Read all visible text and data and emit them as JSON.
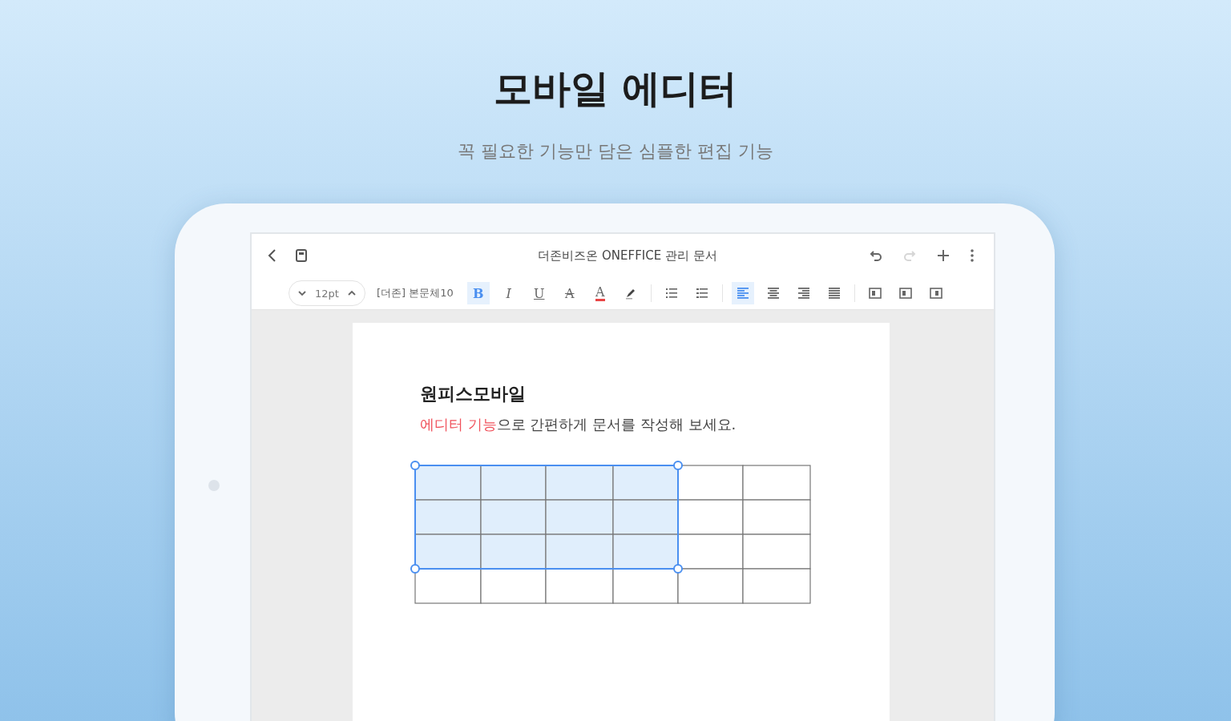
{
  "headline": "모바일 에디터",
  "subtitle": "꼭 필요한 기능만 담은 심플한 편집 기능",
  "editor": {
    "title": "더존비즈온 ONEFFICE 관리 문서",
    "actions": [
      {
        "kind": "undo",
        "disabled": false
      },
      {
        "kind": "redo",
        "disabled": true
      },
      {
        "kind": "add",
        "disabled": false
      },
      {
        "kind": "more",
        "disabled": false
      }
    ],
    "font_size": "12pt",
    "paragraph_style": "[더존] 본문체10",
    "tools": [
      {
        "kind": "bold",
        "label": "B",
        "selected": true
      },
      {
        "kind": "italic",
        "label": "I",
        "selected": false
      },
      {
        "kind": "underline",
        "label": "U",
        "selected": false
      },
      {
        "kind": "strike",
        "label": "A",
        "selected": false
      },
      {
        "kind": "font-color",
        "label": "A",
        "selected": false
      },
      {
        "kind": "highlight",
        "selected": false
      },
      {
        "kind": "separator"
      },
      {
        "kind": "bullets",
        "selected": false
      },
      {
        "kind": "numbering",
        "selected": false
      },
      {
        "kind": "separator"
      },
      {
        "kind": "align-left",
        "selected": true
      },
      {
        "kind": "align-center",
        "selected": false
      },
      {
        "kind": "align-right",
        "selected": false
      },
      {
        "kind": "justify",
        "selected": false
      },
      {
        "kind": "separator"
      },
      {
        "kind": "indent",
        "selected": false
      },
      {
        "kind": "outdent",
        "selected": false
      },
      {
        "kind": "table",
        "selected": false
      }
    ]
  },
  "document": {
    "heading": "원피스모바일",
    "sentence": "**에디터 기능**으로 간편하게 문서를 작성해 보세요.",
    "table": {
      "rows": [
        {
          "cells": [
            {
              "selected": true
            },
            {
              "selected": true
            },
            {
              "selected": true
            },
            {
              "selected": true
            },
            {
              "selected": false
            },
            {
              "selected": false
            }
          ]
        },
        {
          "cells": [
            {
              "selected": true
            },
            {
              "selected": true
            },
            {
              "selected": true
            },
            {
              "selected": true
            },
            {
              "selected": false
            },
            {
              "selected": false
            }
          ]
        },
        {
          "cells": [
            {
              "selected": true
            },
            {
              "selected": true
            },
            {
              "selected": true
            },
            {
              "selected": true
            },
            {
              "selected": false
            },
            {
              "selected": false
            }
          ]
        },
        {
          "cells": [
            {
              "selected": false
            },
            {
              "selected": false
            },
            {
              "selected": false
            },
            {
              "selected": false
            },
            {
              "selected": false
            },
            {
              "selected": false
            }
          ]
        }
      ]
    }
  }
}
